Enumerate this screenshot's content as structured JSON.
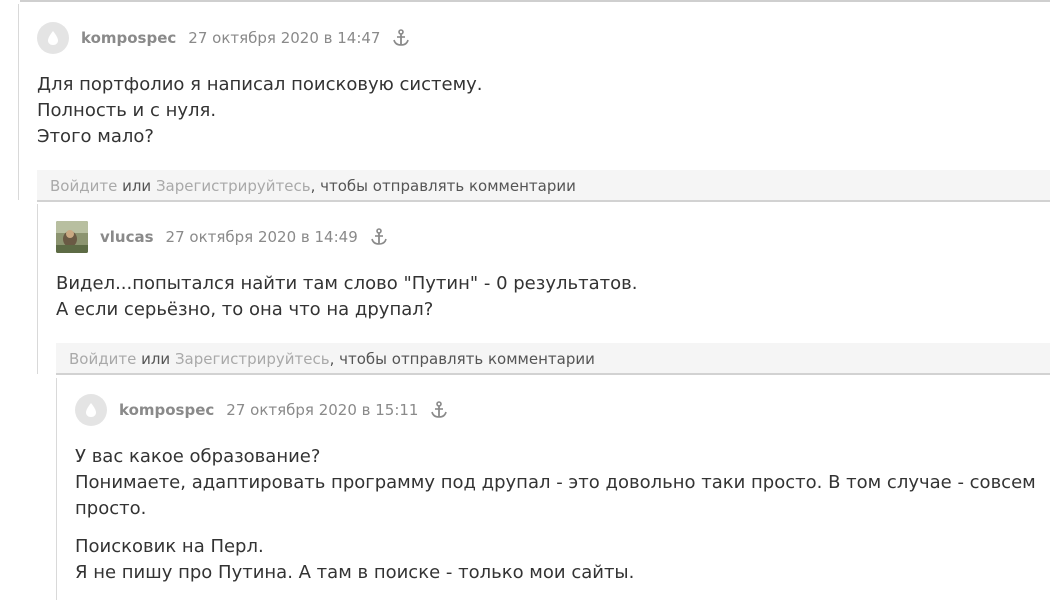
{
  "comments": [
    {
      "author": "kompospec",
      "date": "27 октября 2020 в 14:47",
      "paragraphs": [
        [
          "Для портфолио я написал поисковую систему.",
          "Полность и с нуля.",
          "Этого мало?"
        ]
      ]
    },
    {
      "author": "vlucas",
      "date": "27 октября 2020 в 14:49",
      "paragraphs": [
        [
          "Видел...попытался найти там слово \"Путин\" - 0 результатов.",
          "А если серьёзно, то она что на друпал?"
        ]
      ]
    },
    {
      "author": "kompospec",
      "date": "27 октября 2020 в 15:11",
      "paragraphs": [
        [
          "У вас какое образование?",
          "Понимаете, адаптировать программу под друпал - это довольно таки просто. В том случае - совсем",
          "просто."
        ],
        [
          "Поисковик на Перл.",
          "Я не пишу про Путина. А там в поиске - только мои сайты."
        ]
      ]
    }
  ],
  "login_bar": {
    "login_link": "Войдите",
    "or_text": " или ",
    "register_link": "Зарегистрируйтесь",
    "suffix": ", чтобы отправлять комментарии"
  },
  "icons": {
    "anchor": "anchor-icon",
    "default_avatar": "user-avatar-placeholder-icon"
  }
}
